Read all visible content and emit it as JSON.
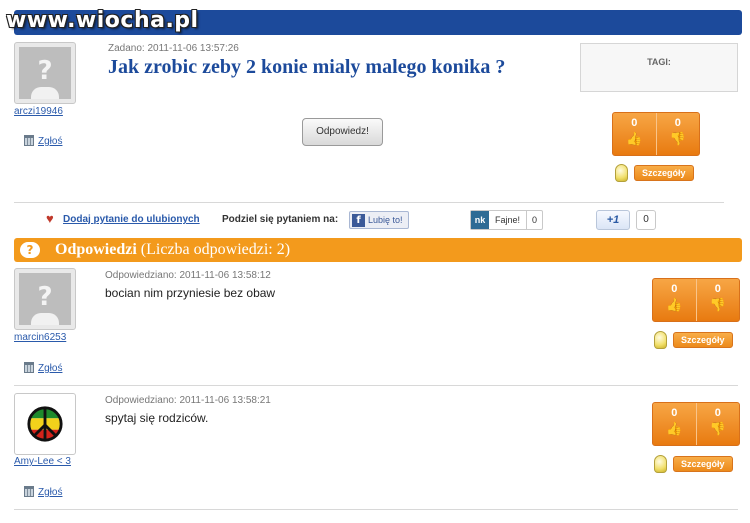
{
  "site": {
    "watermark": "www.wiocha.pl"
  },
  "question": {
    "user": "arczi19946",
    "report_label": "Zgłoś",
    "asked_meta": "Zadano: 2011-11-06 13:57:26",
    "title": "Jak zrobic zeby 2 konie mialy malego konika ?",
    "tags_label": "TAGI:",
    "answer_button": "Odpowiedz!",
    "votes_up": "0",
    "votes_down": "0",
    "details_label": "Szczegóły"
  },
  "share": {
    "favorite_label": "Dodaj pytanie do ulubionych",
    "share_label": "Podziel się pytaniem na:",
    "facebook_label": "Lubię to!",
    "nk_logo": "nk",
    "nk_label": "Fajne!",
    "nk_count": "0",
    "gplus_label": "+1",
    "gplus_count": "0"
  },
  "answers_header": {
    "title": "Odpowiedzi",
    "count_text": "(Liczba odpowiedzi: 2)"
  },
  "answers": [
    {
      "user": "marcin6253",
      "meta": "Odpowiedziano: 2011-11-06 13:58:12",
      "text": "bocian nim przyniesie bez obaw",
      "report_label": "Zgłoś",
      "votes_up": "0",
      "votes_down": "0",
      "details_label": "Szczegóły"
    },
    {
      "user": "Amy-Lee < 3",
      "meta": "Odpowiedziano: 2011-11-06 13:58:21",
      "text": "spytaj się rodziców.",
      "report_label": "Zgłoś",
      "votes_up": "0",
      "votes_down": "0",
      "details_label": "Szczegóły"
    }
  ],
  "colors": {
    "blue_bar": "#1c4a9b",
    "orange": "#f39a1c",
    "link": "#2a5aab"
  },
  "icons": {
    "trash": "trash-icon",
    "thumb_up": "thumb-up-icon",
    "thumb_down": "thumb-down-icon",
    "bulb": "lightbulb-icon",
    "heart": "heart-icon",
    "question": "question-icon",
    "peace": "peace-sign-icon"
  }
}
